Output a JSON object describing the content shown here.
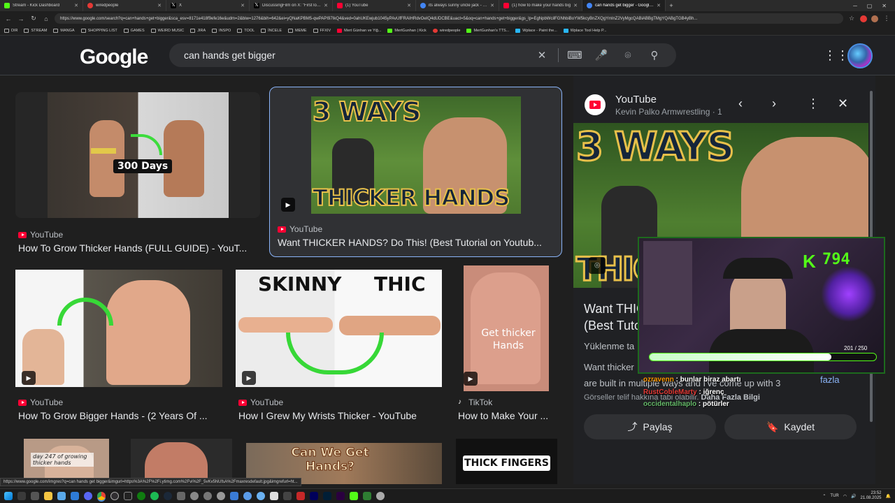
{
  "browser": {
    "tabs": [
      {
        "title": "Stream - Kick Dashboard",
        "color": "#53fc18"
      },
      {
        "title": "wiredpeople",
        "color": "#e53935"
      },
      {
        "title": "X",
        "color": "#ffffff"
      },
      {
        "title": "DiscussingFilm on X: \"First look at",
        "color": "#ffffff"
      },
      {
        "title": "(1) YouTube",
        "color": "#ff0033"
      },
      {
        "title": "its always sunny uncle jack - Goo",
        "color": "#4285f4"
      },
      {
        "title": "(1) how to make your hands big",
        "color": "#ff0033"
      },
      {
        "title": "can hands get bigger - Google'da",
        "color": "#4285f4"
      }
    ],
    "url": "https://www.google.com/search?q=can+hands+get+bigger&sca_esv=8171e418f9efe16e&udm=2&biw=1276&bih=642&ei=yQNaKPBM5-qwPAPI97IkQ4&ved=0ahUKEwjub1045yPAvUfFRAIHRdvOeIQ4dUDCBE&uact=5&oq=can+hands+get+bigger&gs_lp=EgNpbWcilFGNhbiBoYW5kcyBnZXQgYmlnZ2VyMgcQABiABBgTMgYQABgTGB4yBh...",
    "bookmarks": [
      "DIR",
      "STREAM",
      "MANGA",
      "SHOPPING LIST",
      "GAMES",
      "WEIRD MUSIC",
      "JIRA",
      "INSPO",
      "TOOL",
      "İNCELE",
      "MEME",
      "FFXIV",
      "Mert Günhan ve Yiğ...",
      "MertGunhan | Kick",
      "wiredpeople",
      "MertGunhan's TTS...",
      "Wplace - Paint the...",
      "Wplace Tool Help P..."
    ],
    "status_url": "https://www.google.com/imgres?q=can hands get bigger&imgurl=https%3A%2F%2Fi.ytimg.com%2Fvi%2F_5vKv5NUfsA%2Fmaxresdefault.jpg&imgrefurl=ht..."
  },
  "google": {
    "logo": "Google",
    "query": "can hands get bigger",
    "icons": [
      "clear-icon",
      "keyboard-icon",
      "microphone-icon",
      "lens-icon",
      "search-icon"
    ]
  },
  "results": [
    {
      "source": "YouTube",
      "caption": "How To Grow Thicker Hands (FULL GUIDE) - YouT...",
      "overlay": "300 Days",
      "source_type": "youtube"
    },
    {
      "source": "YouTube",
      "caption": "Want THICKER HANDS? Do This! (Best Tutorial on Youtub...",
      "overlay_top": "3 WAYS",
      "overlay_bottom": "THICKER HANDS",
      "source_type": "youtube"
    },
    {
      "source": "YouTube",
      "caption": "How To Grow Bigger Hands - (2 Years Of ...",
      "source_type": "youtube"
    },
    {
      "source": "YouTube",
      "caption": "How I Grew My Wrists Thicker - YouTube",
      "overlay_left": "SKINNY",
      "overlay_right": "THIC",
      "source_type": "youtube"
    },
    {
      "source": "TikTok",
      "caption": "How to Make Your ...",
      "overlay": "Get thicker Hands",
      "source_type": "tiktok"
    },
    {
      "overlay": "day 247 of growing thicker hands"
    },
    {},
    {
      "overlay": "Can We Get Hands?"
    },
    {
      "overlay": "THICK FINGERS"
    }
  ],
  "panel": {
    "source": "YouTube",
    "channel": "Kevin Palko Armwrestling · 1",
    "image_top": "3 WAYS",
    "image_bottom": "THIC",
    "title_line1": "Want THIC",
    "title_line2": "(Best Tuto",
    "uploaded": "Yüklenme ta",
    "desc_line1": "Want thicker",
    "desc_line2": "are built in multiple ways and I've come up with 3",
    "more": "fazla",
    "copyright": "Görseller telif hakkına tabi olabilir.",
    "more_info": "Daha Fazla Bilgi",
    "share_label": "Paylaş",
    "save_label": "Kaydet"
  },
  "stream": {
    "kick_count": "794",
    "progress_text": "201 / 250",
    "progress": 0.804,
    "chat": [
      {
        "user": "ozravenn",
        "msg": "bunlar biraz abartı",
        "color": "#ff9800"
      },
      {
        "user": "RustCobleMarty",
        "msg": "iğrenç",
        "color": "#e53935"
      },
      {
        "user": "occidentalhaplo",
        "msg": "pötürler",
        "color": "#66bb6a"
      }
    ]
  },
  "taskbar": {
    "lang": "TUR",
    "time": "23:52",
    "date": "21.08.2025"
  },
  "colors": {
    "background": "#1f1f1f",
    "accent_blue": "#8ab4f8",
    "youtube_red": "#ff0033",
    "kick_green": "#53fc18"
  }
}
